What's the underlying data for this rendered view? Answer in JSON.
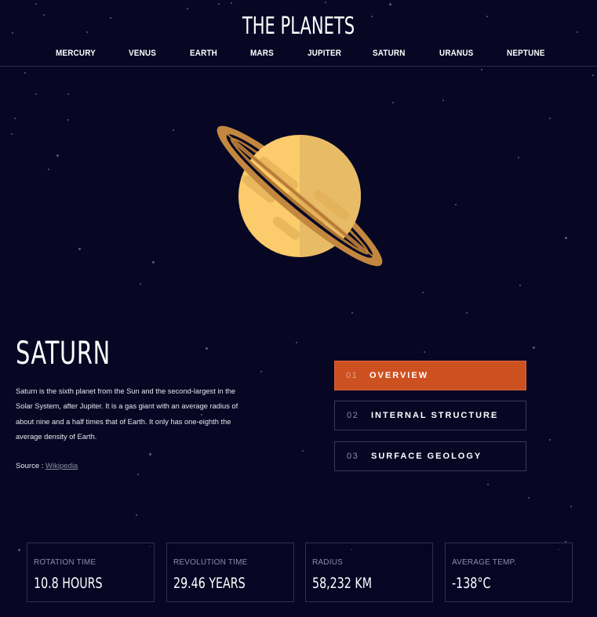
{
  "app": {
    "title": "THE PLANETS"
  },
  "nav": {
    "items": [
      {
        "label": "MERCURY"
      },
      {
        "label": "VENUS"
      },
      {
        "label": "EARTH"
      },
      {
        "label": "MARS"
      },
      {
        "label": "JUPITER"
      },
      {
        "label": "SATURN"
      },
      {
        "label": "URANUS"
      },
      {
        "label": "NEPTUNE"
      }
    ]
  },
  "planet": {
    "name": "SATURN",
    "image_icon": "saturn-illustration",
    "description": "Saturn is the sixth planet from the Sun and the second-largest in the Solar System, after Jupiter. It is a gas giant with an average radius of about nine and a half times that of Earth. It only has one-eighth the average density of Earth.",
    "source_label": "Source : ",
    "source_link": "Wikipedia"
  },
  "tabs": [
    {
      "num": "01",
      "label": "OVERVIEW",
      "active": true
    },
    {
      "num": "02",
      "label": "INTERNAL STRUCTURE",
      "active": false
    },
    {
      "num": "03",
      "label": "SURFACE GEOLOGY",
      "active": false
    }
  ],
  "stats": [
    {
      "label": "ROTATION TIME",
      "value": "10.8 HOURS"
    },
    {
      "label": "REVOLUTION TIME",
      "value": "29.46 YEARS"
    },
    {
      "label": "RADIUS",
      "value": "58,232 KM"
    },
    {
      "label": "AVERAGE TEMP.",
      "value": "-138°C"
    }
  ],
  "colors": {
    "background": "#070724",
    "accent": "#CD5120",
    "planet_light": "#FCCB6B",
    "planet_dark": "#E8BB66",
    "ring": "#C4873F"
  }
}
